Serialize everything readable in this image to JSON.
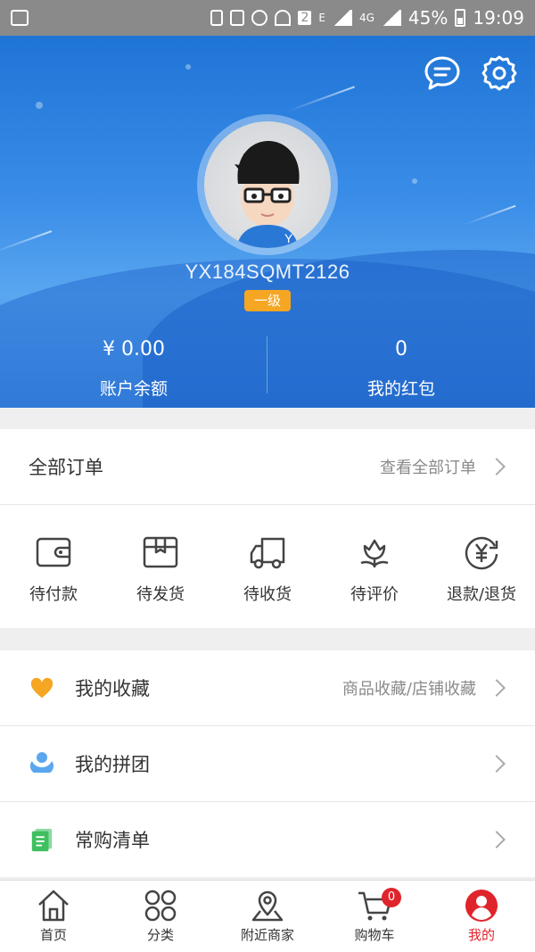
{
  "status_bar": {
    "sim_label": "2",
    "network_e": "E",
    "network_4g": "4G",
    "battery": "45%",
    "time": "19:09"
  },
  "header": {
    "username": "YX184SQMT2126",
    "level": "一级",
    "balance_value": "¥ 0.00",
    "balance_label": "账户余额",
    "redpacket_value": "0",
    "redpacket_label": "我的红包",
    "icons": [
      "message-icon",
      "settings-icon"
    ]
  },
  "orders": {
    "title": "全部订单",
    "view_all": "查看全部订单",
    "items": [
      {
        "label": "待付款",
        "icon": "wallet-icon"
      },
      {
        "label": "待发货",
        "icon": "box-icon"
      },
      {
        "label": "待收货",
        "icon": "truck-icon"
      },
      {
        "label": "待评价",
        "icon": "flower-icon"
      },
      {
        "label": "退款/退货",
        "icon": "yen-return-icon"
      }
    ]
  },
  "menu": [
    {
      "label": "我的收藏",
      "sub": "商品收藏/店铺收藏",
      "icon": "heart-icon"
    },
    {
      "label": "我的拼团",
      "sub": "",
      "icon": "group-icon"
    },
    {
      "label": "常购清单",
      "sub": "",
      "icon": "list-icon"
    }
  ],
  "tabbar": {
    "items": [
      {
        "label": "首页",
        "icon": "home-icon"
      },
      {
        "label": "分类",
        "icon": "category-icon"
      },
      {
        "label": "附近商家",
        "icon": "location-icon"
      },
      {
        "label": "购物车",
        "icon": "cart-icon"
      },
      {
        "label": "我的",
        "icon": "user-icon"
      }
    ],
    "cart_badge": "0",
    "active_color": "#e0242c"
  },
  "colors": {
    "accent": "#1f74d6",
    "level_badge": "#f5a623",
    "heart": "#f5a623",
    "group": "#5aa7f0",
    "list": "#3fbf5f"
  }
}
